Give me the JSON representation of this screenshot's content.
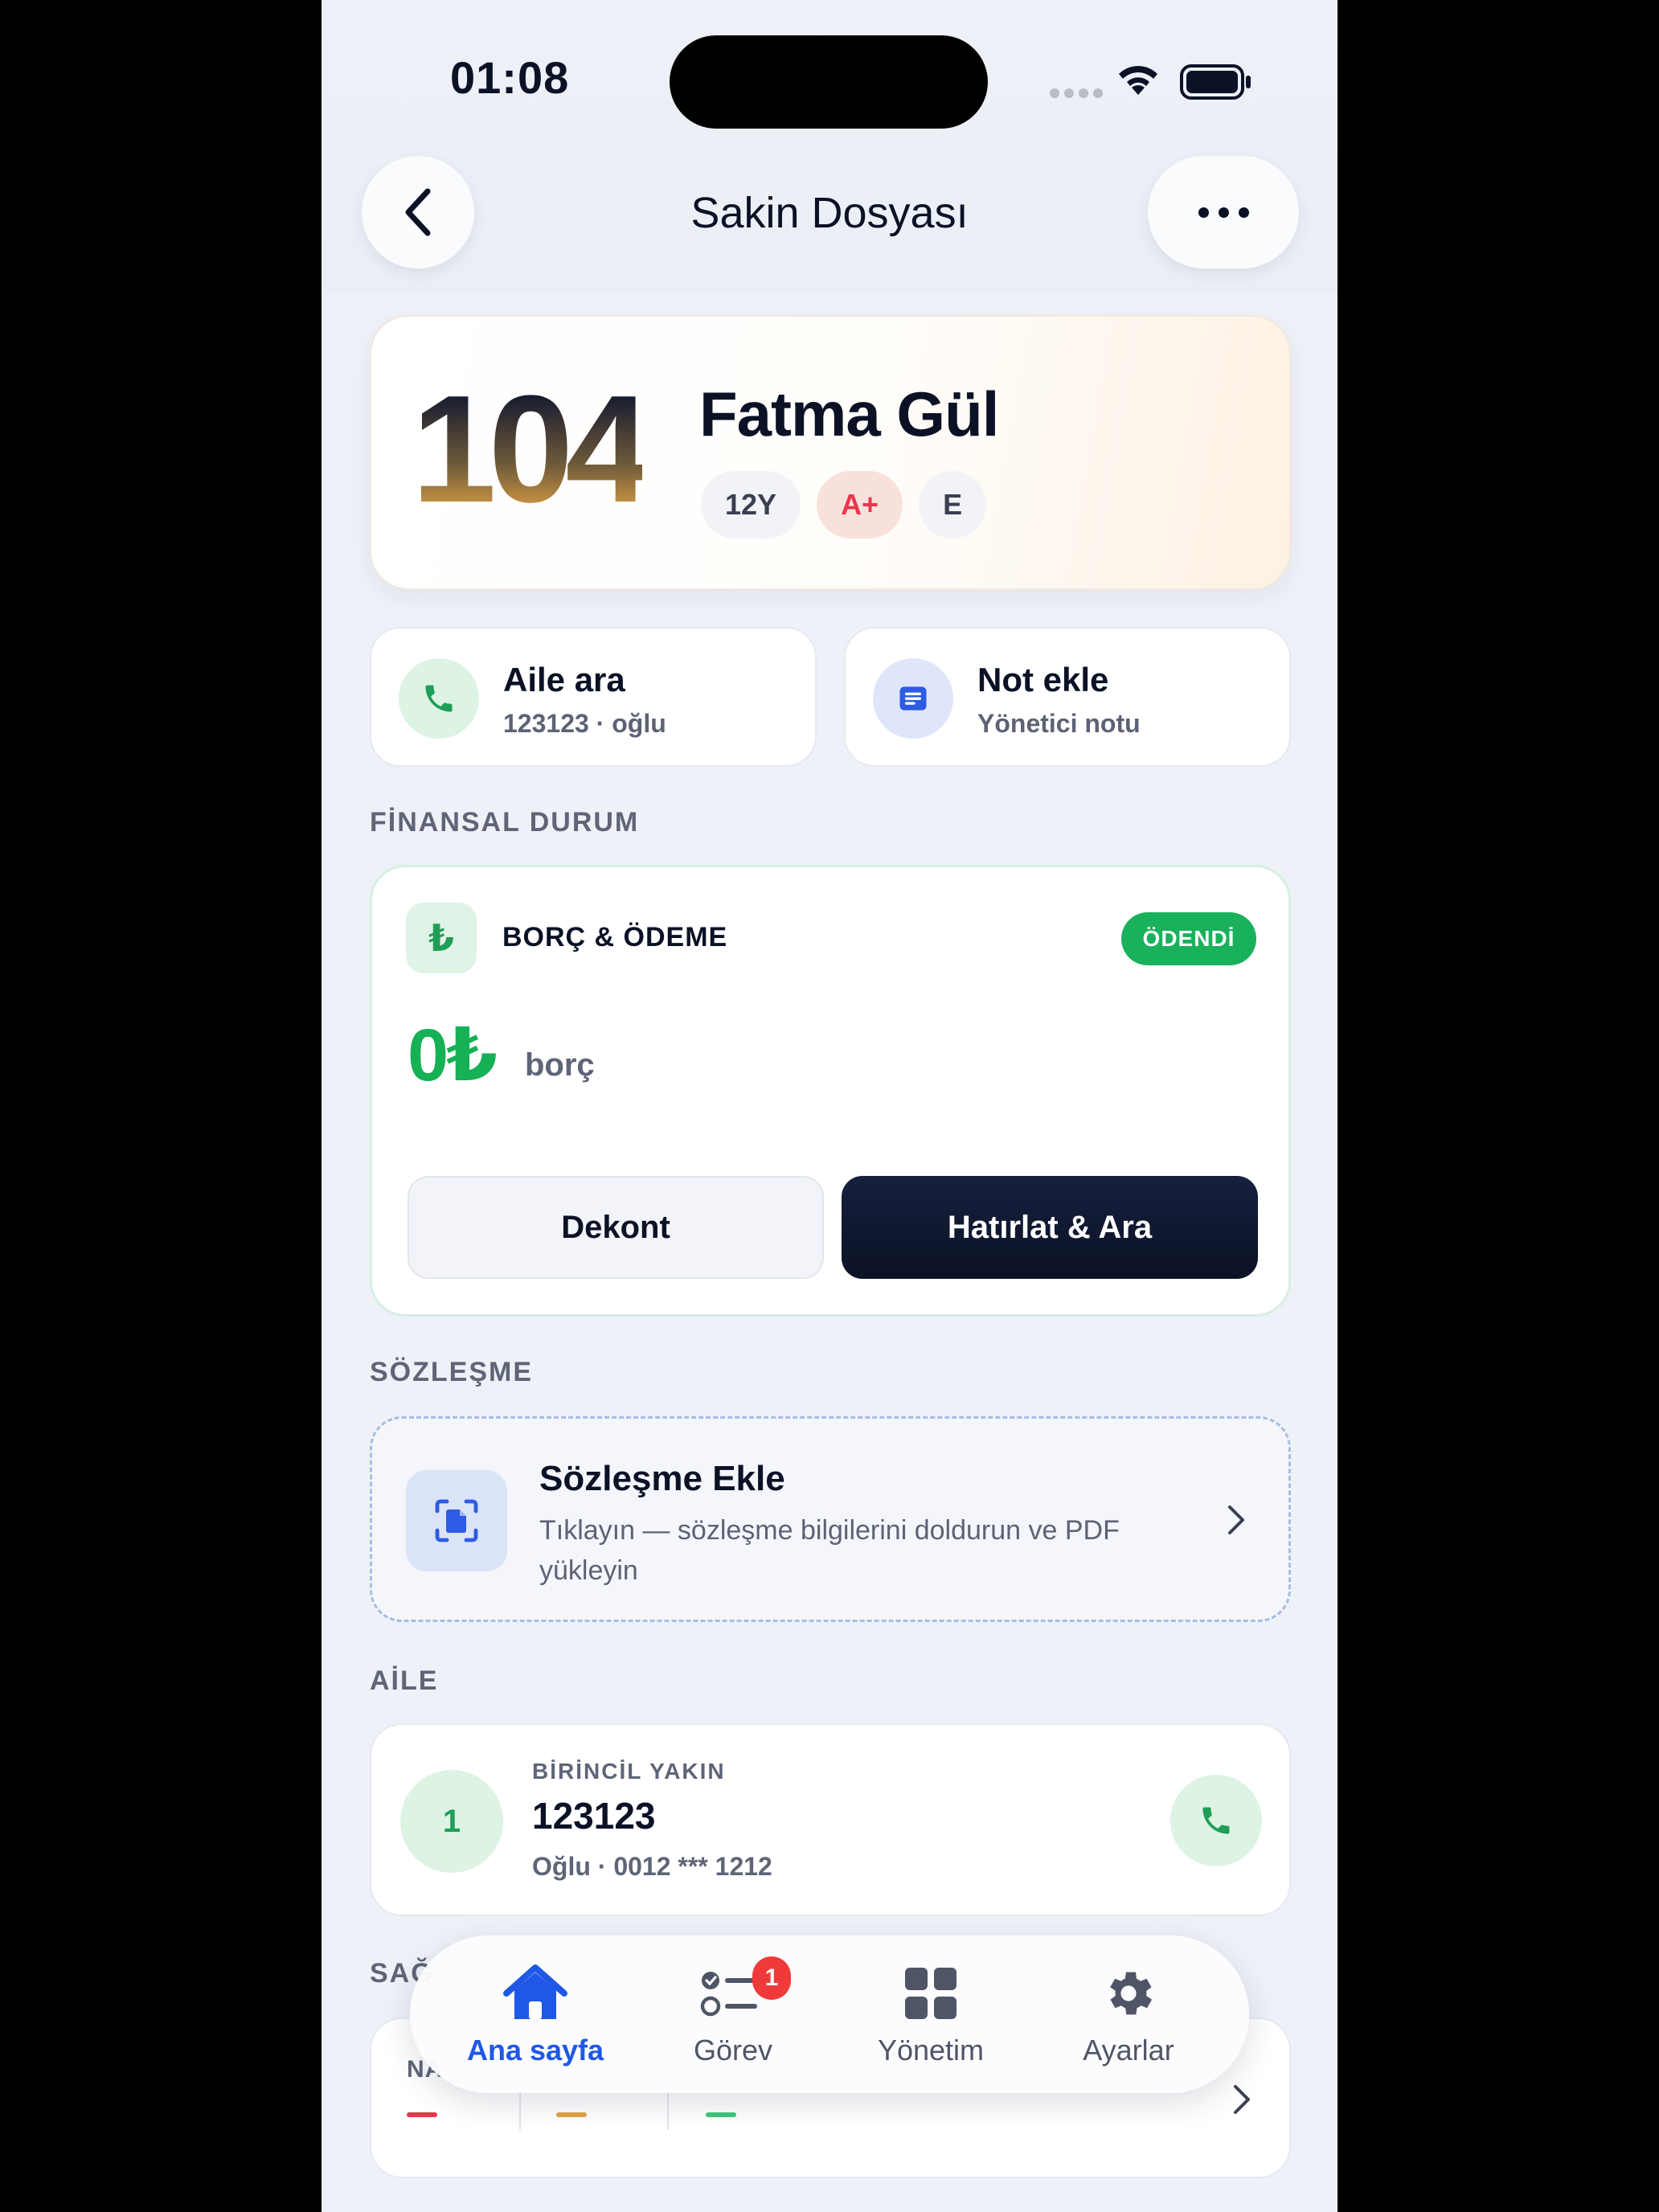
{
  "status_bar": {
    "time": "01:08"
  },
  "header": {
    "title": "Sakin Dosyası"
  },
  "resident": {
    "unit": "104",
    "name": "Fatma Gül",
    "chips": [
      "12Y",
      "A+",
      "E"
    ]
  },
  "quick_actions": {
    "call_family": {
      "title": "Aile ara",
      "subtitle": "123123 · oğlu"
    },
    "add_note": {
      "title": "Not ekle",
      "subtitle": "Yönetici notu"
    }
  },
  "finance": {
    "section_label": "FİNANSAL DURUM",
    "icon_symbol": "₺",
    "title": "BORÇ & ÖDEME",
    "status_badge": "ÖDENDİ",
    "amount": "0₺",
    "amount_label": "borç",
    "receipt_button": "Dekont",
    "remind_button": "Hatırlat & Ara"
  },
  "contract": {
    "section_label": "SÖZLEŞME",
    "title": "Sözleşme Ekle",
    "description": "Tıklayın — sözleşme bilgilerini doldurun ve PDF yükleyin"
  },
  "family": {
    "section_label": "AİLE",
    "index": "1",
    "kicker": "BİRİNCİL YAKIN",
    "name": "123123",
    "detail": "Oğlu · 0012 *** 1212"
  },
  "health": {
    "section_label_partial": "SAĞ",
    "card_label_partial": "NA"
  },
  "tabbar": {
    "items": [
      {
        "label": "Ana sayfa",
        "icon": "home-icon",
        "active": true
      },
      {
        "label": "Görev",
        "icon": "tasks-icon",
        "badge": "1"
      },
      {
        "label": "Yönetim",
        "icon": "grid-icon"
      },
      {
        "label": "Ayarlar",
        "icon": "gear-icon"
      }
    ]
  },
  "colors": {
    "accent_blue": "#1f57e7",
    "success_green": "#19b15b",
    "dark_navy": "#0b1226",
    "badge_red": "#f03a3a"
  }
}
